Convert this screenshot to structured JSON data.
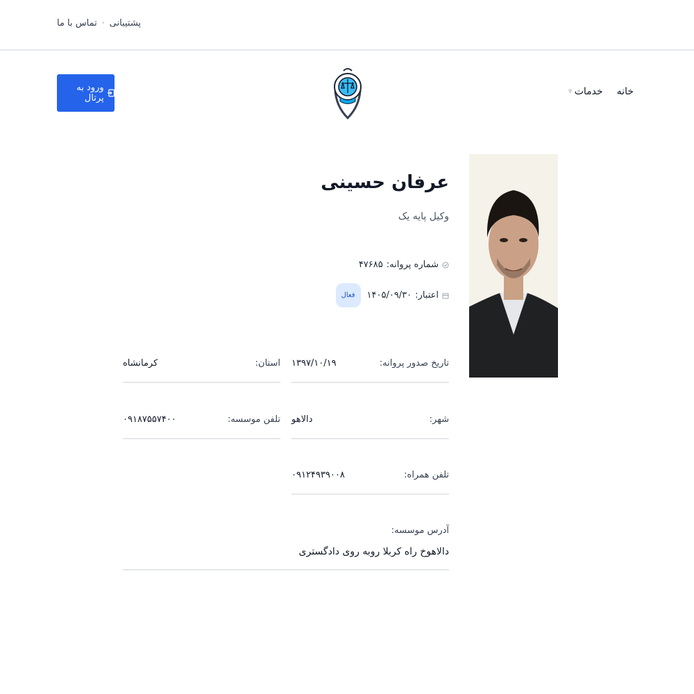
{
  "topbar": {
    "support": "پشتیبانی",
    "contact": "تماس با ما"
  },
  "header": {
    "portal_button": "ورود به پرتال",
    "nav_home": "خانه",
    "nav_services": "خدمات"
  },
  "profile": {
    "name": "عرفان حسینی",
    "rank": "وکیل پایه یک",
    "license_label": "شماره پروانه:",
    "license_value": "۴۷۶۸۵",
    "validity_label": "اعتبار:",
    "validity_value": "۱۴۰۵/۰۹/۳۰",
    "status_badge": "فعال"
  },
  "details": {
    "issue_date_label": "تاریخ صدور پروانه:",
    "issue_date_value": "۱۳۹۷/۱۰/۱۹",
    "province_label": "استان:",
    "province_value": "کرمانشاه",
    "city_label": "شهر:",
    "city_value": "دالاهو",
    "office_phone_label": "تلفن موسسه:",
    "office_phone_value": "۰۹۱۸۷۵۵۷۴۰۰",
    "mobile_label": "تلفن همراه:",
    "mobile_value": "۰۹۱۲۴۹۳۹۰۰۸",
    "address_label": "آدرس موسسه:",
    "address_value": "دالاهوخ راه کربلا روبه روی دادگستری"
  },
  "colors": {
    "primary": "#2563eb",
    "badge_bg": "#dbeafe",
    "badge_text": "#1d4ed8",
    "divider": "#e5e7eb"
  },
  "icons": {
    "portal": "login-icon",
    "license": "check-circle-icon",
    "validity": "calendar-icon",
    "chevron": "chevron-down-icon"
  }
}
